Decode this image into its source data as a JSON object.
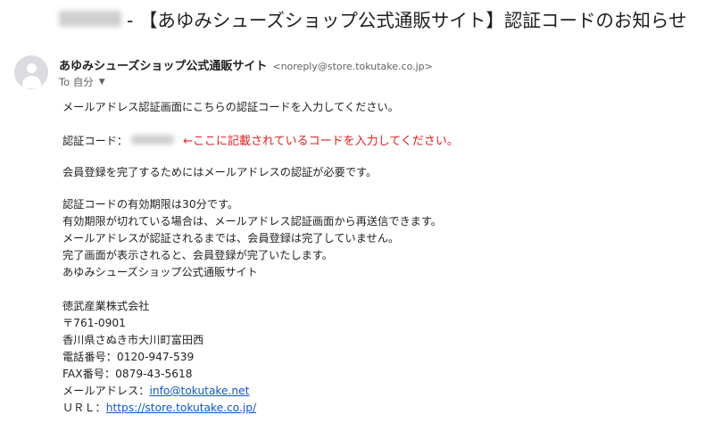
{
  "subject": {
    "text": "- 【あゆみシューズショップ公式通販サイト】認証コードのお知らせ"
  },
  "sender": {
    "name": "あゆみシューズショップ公式通販サイト",
    "address": "<noreply@store.tokutake.co.jp>",
    "to_label": "To 自分"
  },
  "body": {
    "line1": "メールアドレス認証画面にこちらの認証コードを入力してください。",
    "code_label": "認証コード：",
    "code_note": "←ここに記載されているコードを入力してください。",
    "line3": "会員登録を完了するためにはメールアドレスの認証が必要です。",
    "line4": "認証コードの有効期限は30分です。",
    "line5": "有効期限が切れている場合は、メールアドレス認証画面から再送信できます。",
    "line6": "メールアドレスが認証されるまでは、会員登録は完了していません。",
    "line7": "完了画面が表示されると、会員登録が完了いたします。",
    "line8": "あゆみシューズショップ公式通販サイト"
  },
  "signature": {
    "company": "徳武産業株式会社",
    "postal": "〒761-0901",
    "address": "香川県さぬき市大川町富田西",
    "tel": "電話番号：0120-947-539",
    "fax": "FAX番号：0879-43-5618",
    "email_label": "メールアドレス：",
    "email": "info@tokutake.net",
    "url_label": "ＵＲＬ：",
    "url": "https://store.tokutake.co.jp/"
  },
  "colors": {
    "note": "#e02020",
    "link": "#1155cc"
  }
}
